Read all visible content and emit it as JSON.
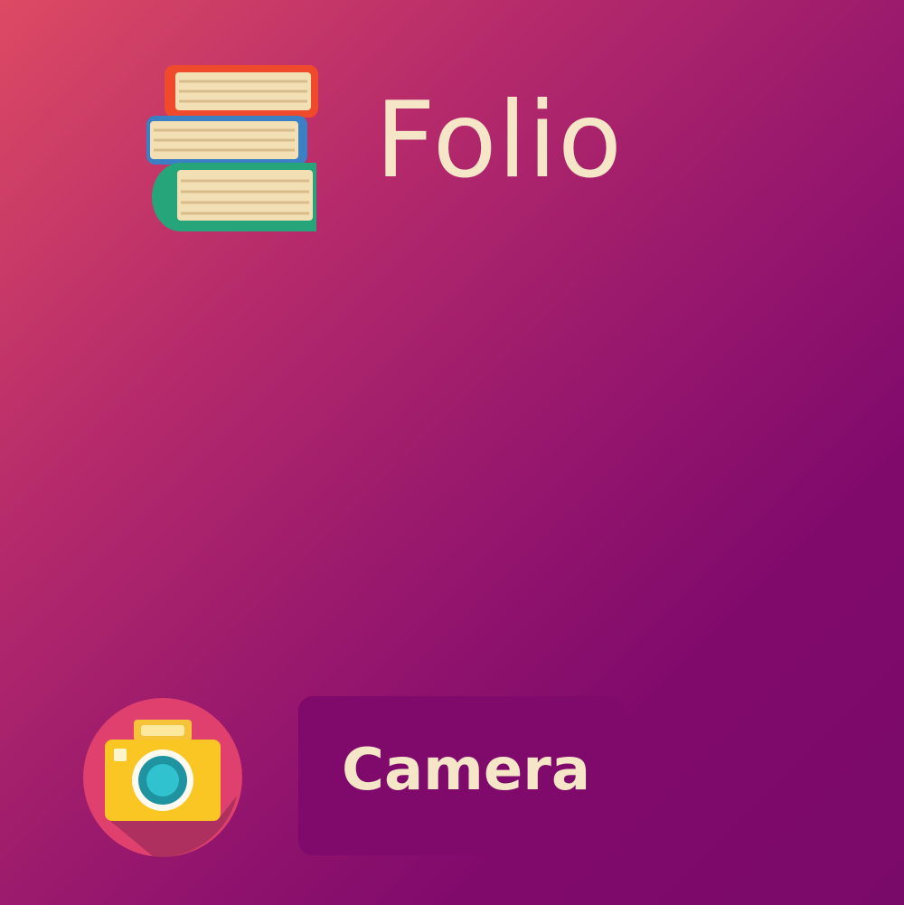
{
  "app": {
    "title": "Folio",
    "logo_icon": "books-stack-icon"
  },
  "camera": {
    "label": "Camera",
    "icon": "camera-icon"
  },
  "colors": {
    "text": "#f5e6c8",
    "button_bg": "#7f0a6b",
    "gradient_start": "#dc4a63",
    "gradient_end": "#7a0a6a"
  }
}
